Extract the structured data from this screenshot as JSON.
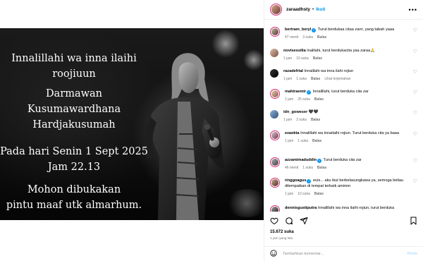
{
  "post": {
    "caption_lines": [
      "Innalillahi wa inna ilaihi",
      "roojiuun",
      "Darmawan",
      "Kusumawardhana",
      "Hardjakusumah",
      "Pada hari Senin 1 Sept 2025",
      "Jam 22.13",
      "Mohon dibukakan",
      "pintu maaf utk almarhum."
    ]
  },
  "header": {
    "username": "zaraadhsty",
    "separator": "•",
    "follow_label": "Ikuti",
    "more_icon": "more-horizontal-icon"
  },
  "comments": [
    {
      "user": "bertram_beryl",
      "verified": true,
      "text": "Turut berdukaa citaa zarrr, yang tabah yaaa",
      "time": "47 menit",
      "likes": "3 suka",
      "reply": "Balas",
      "extra": ""
    },
    {
      "user": "novisessilia",
      "verified": false,
      "text": "Inalilahi, turut berdukacita yaa zaraa🙏",
      "time": "1 jam",
      "likes": "10 suka",
      "reply": "Balas",
      "extra": ""
    },
    {
      "user": "razadefrial",
      "verified": false,
      "text": "Innalilahi wa inna ilahi rojiun",
      "time": "1 jam",
      "likes": "1 suka",
      "reply": "Balas",
      "extra": "Lihat terjemahan"
    },
    {
      "user": "mahiraemir",
      "verified": true,
      "text": "Innalillahi, turut berduka cita zar",
      "time": "1 jam",
      "likes": "25 suka",
      "reply": "Balas",
      "extra": ""
    },
    {
      "user": "idn_goweser",
      "verified": false,
      "text": "🖤🖤",
      "time": "1 jam",
      "likes": "3 suka",
      "reply": "Balas",
      "extra": ""
    },
    {
      "user": "ezaokta",
      "verified": false,
      "text": "Innalillahi wa innailaihi rojiun. Turut berduka cita ya baaa",
      "time": "1 jam",
      "likes": "1 suka",
      "reply": "Balas",
      "extra": ""
    },
    {
      "user": "azzamimaduddin",
      "verified": true,
      "text": "Turut berduka cita zar",
      "time": "46 menit",
      "likes": "1 suka",
      "reply": "Balas",
      "extra": ""
    },
    {
      "user": "ringgoagus",
      "verified": true,
      "text": "euis... aku ikut berbelasungkawa ya, semoga beliau ditempatkan di tempat terbaik aminnn",
      "time": "1 jam",
      "likes": "10 suka",
      "reply": "Balas",
      "extra": ""
    },
    {
      "user": "dennisgustiputra",
      "verified": false,
      "text": "Innalillahi wa inna ilaihi rojiun, turut berduka",
      "time": "",
      "likes": "",
      "reply": "",
      "extra": ""
    }
  ],
  "actions": {
    "like_icon": "heart-icon",
    "comment_icon": "comment-icon",
    "share_icon": "share-icon",
    "save_icon": "bookmark-icon"
  },
  "likes_count": "15.672 suka",
  "time_ago": "1 jam yang lalu",
  "add_comment": {
    "emoji_icon": "emoji-icon",
    "placeholder": "Tambahkan komentar...",
    "post_label": "Kirim"
  },
  "colors": {
    "accent": "#0095f6",
    "muted": "#737373",
    "story_ring": "#d62976"
  }
}
